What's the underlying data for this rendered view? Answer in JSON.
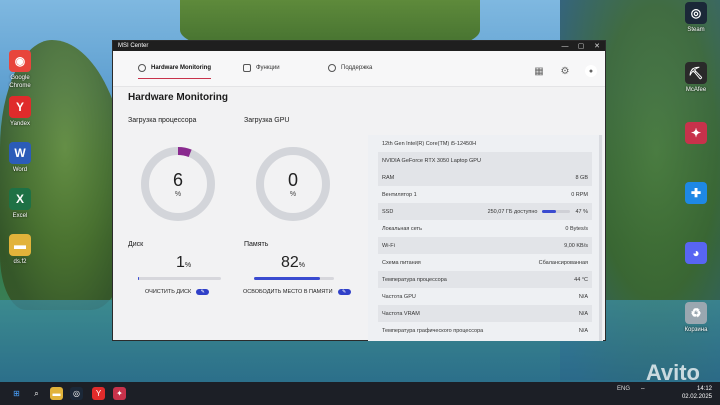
{
  "window": {
    "title": "MSI Center",
    "controls": {
      "minimize": "—",
      "maximize": "▢",
      "close": "✕"
    }
  },
  "nav": {
    "tabs": [
      {
        "label": "Hardware Monitoring"
      },
      {
        "label": "Функции"
      },
      {
        "label": "Поддержка"
      }
    ],
    "icons": [
      "grid-icon",
      "gear-icon",
      "profile-icon"
    ]
  },
  "main": {
    "title": "Hardware Monitoring",
    "cpu": {
      "label": "Загрузка процессора",
      "value": "6",
      "unit": "%",
      "percent": 6
    },
    "gpu": {
      "label": "Загрузка GPU",
      "value": "0",
      "unit": "%",
      "percent": 0
    },
    "disk": {
      "label": "Диск",
      "value": "1",
      "unit": "%",
      "percent": 1,
      "action": "ОЧИСТИТЬ ДИСК"
    },
    "memory": {
      "label": "Память",
      "value": "82",
      "unit": "%",
      "percent": 82,
      "action": "ОСВОБОДИТЬ МЕСТО В ПАМЯТИ"
    }
  },
  "panel": {
    "cpu_name": "12th Gen Intel(R) Core(TM) i5-12450H",
    "gpu_name": "NVIDIA GeForce RTX 3050 Laptop GPU",
    "rows": [
      {
        "k": "RAM",
        "v": "8 GB"
      },
      {
        "k": "Вентилятор 1",
        "v": "0 RPM"
      },
      {
        "k": "SSD",
        "v": "47 %",
        "extra": "250,07 ГБ доступно",
        "percent": 47
      },
      {
        "k": "Локальная сеть",
        "v": "0 Bytes/s"
      },
      {
        "k": "Wi-Fi",
        "v": "9,00 KB/s"
      },
      {
        "k": "Схема питания",
        "v": "Сбалансированная"
      },
      {
        "k": "Температура процессора",
        "v": "44 °C"
      },
      {
        "k": "Частота GPU",
        "v": "N/A"
      },
      {
        "k": "Частота VRAM",
        "v": "N/A"
      },
      {
        "k": "Температура графического процессора",
        "v": "N/A"
      }
    ]
  },
  "desktop": {
    "icons_left": [
      {
        "label": "Google Chrome",
        "color": "#e8453c",
        "glyph": "◉"
      },
      {
        "label": "Yandex",
        "color": "#e02b2b",
        "glyph": "Y"
      },
      {
        "label": "Word",
        "color": "#2b5cb8",
        "glyph": "W"
      },
      {
        "label": "Excel",
        "color": "#1e7145",
        "glyph": "X"
      },
      {
        "label": "ds.f2",
        "color": "#e2b33a",
        "glyph": "▬"
      }
    ],
    "icons_right": [
      {
        "label": "Steam",
        "color": "#1b2838",
        "glyph": "◎"
      },
      {
        "label": "McAfee",
        "color": "#2a2a2a",
        "glyph": "⛏"
      },
      {
        "label": "",
        "color": "#c8324b",
        "glyph": "✦"
      },
      {
        "label": "",
        "color": "#1e88e5",
        "glyph": "✚"
      },
      {
        "label": "",
        "color": "#5865f2",
        "glyph": "◕"
      },
      {
        "label": "Корзина",
        "color": "#9aa7b0",
        "glyph": "♻"
      }
    ]
  },
  "taskbar": {
    "lang": "ENG",
    "time": "14:12",
    "date": "02.02.2025"
  },
  "watermark": "Avito"
}
